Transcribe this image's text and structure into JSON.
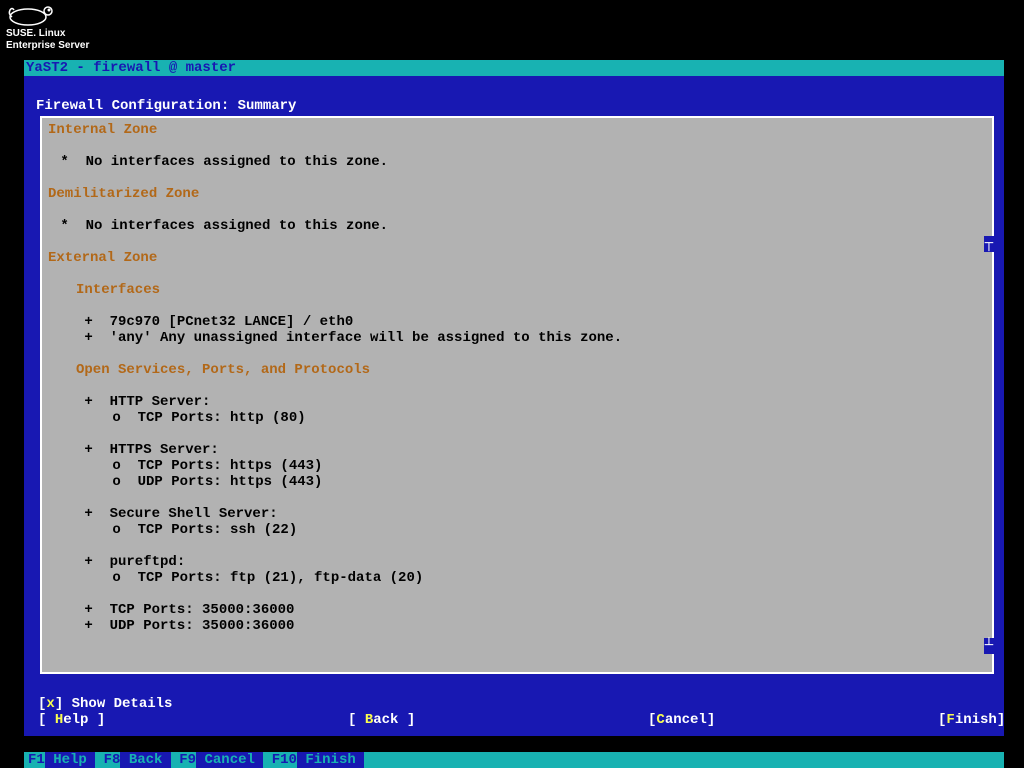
{
  "logo": {
    "line1": "SUSE. Linux",
    "line2": "Enterprise Server"
  },
  "titlebar": "YaST2 - firewall @ master",
  "screen_title": "Firewall Configuration: Summary",
  "zones": {
    "internal": {
      "header": "Internal Zone",
      "line1": " *  No interfaces assigned to this zone."
    },
    "dmz": {
      "header": "Demilitarized Zone",
      "line1": " *  No interfaces assigned to this zone."
    },
    "external": {
      "header": "External Zone",
      "interfaces_header": "Interfaces",
      "if1": " +  79c970 [PCnet32 LANCE] / eth0",
      "if2": " +  'any' Any unassigned interface will be assigned to this zone.",
      "services_header": "Open Services, Ports, and Protocols",
      "svc_http": " +  HTTP Server:",
      "svc_http_p1": " o  TCP Ports: http (80)",
      "svc_https": " +  HTTPS Server:",
      "svc_https_p1": " o  TCP Ports: https (443)",
      "svc_https_p2": " o  UDP Ports: https (443)",
      "svc_ssh": " +  Secure Shell Server:",
      "svc_ssh_p1": " o  TCP Ports: ssh (22)",
      "svc_ftp": " +  pureftpd:",
      "svc_ftp_p1": " o  TCP Ports: ftp (21), ftp-data (20)",
      "svc_tcp_range": " +  TCP Ports: 35000:36000",
      "svc_udp_range": " +  UDP Ports: 35000:36000"
    }
  },
  "checkbox": {
    "prefix": "[",
    "mark": "x",
    "suffix": "] Show Details"
  },
  "buttons": {
    "help_open": "[ ",
    "help_key": "H",
    "help_rest": "elp ]",
    "back_open": "[ ",
    "back_key": "B",
    "back_rest": "ack ]",
    "cancel_open": "[",
    "cancel_key": "C",
    "cancel_rest": "ancel]",
    "finish_open": "[",
    "finish_key": "F",
    "finish_rest": "inish]"
  },
  "fkeys": {
    "f1": "F1",
    "f1_label": " Help ",
    "f8": "F8",
    "f8_label": " Back ",
    "f9": "F9",
    "f9_label": " Cancel ",
    "f10": "F10",
    "f10_label": " Finish "
  }
}
